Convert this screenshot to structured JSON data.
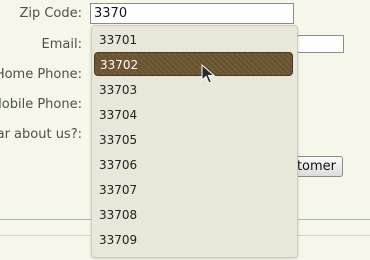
{
  "form": {
    "zip_label": "Zip Code:",
    "zip_value": "3370",
    "email_label": "Email:",
    "home_phone_label": "Home Phone:",
    "mobile_phone_label": "Mobile Phone:",
    "hear_label": "ar about us?:",
    "submit_label": "tomer"
  },
  "autocomplete": {
    "items": [
      "33701",
      "33702",
      "33703",
      "33704",
      "33705",
      "33706",
      "33707",
      "33708",
      "33709"
    ],
    "highlighted_index": 1
  },
  "colors": {
    "page_background": "#f7f6ea",
    "dropdown_background": "#e9e6da",
    "highlight_background": "#6e5633",
    "divider": "#aab7c0"
  },
  "icons": {
    "pointer": "mouse-pointer-icon"
  }
}
